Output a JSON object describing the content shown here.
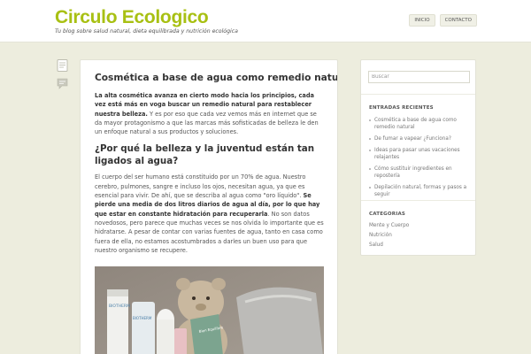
{
  "header": {
    "site_title": "Circulo Ecologico",
    "site_description": "Tu blog sobre salud natural, dieta equilibrada y nutrición ecológica",
    "nav": [
      {
        "label": "INICIO"
      },
      {
        "label": "CONTACTO"
      }
    ]
  },
  "side_icons": [
    "document-icon",
    "comment-icon"
  ],
  "post": {
    "title": "Cosmética a base de agua como remedio natural",
    "intro_bold": "La alta cosmética avanza en cierto modo hacia los principios, cada vez está más en voga buscar un remedio natural para restablecer nuestra belleza.",
    "intro_rest": " Y es por eso que cada vez vemos más en internet que se da mayor protagonismo a que las marcas más sofisticadas de belleza le den un enfoque natural a sus productos y soluciones.",
    "subheading": "¿Por qué la belleza y la juventud están tan ligados al agua?",
    "body_1": "El cuerpo del ser humano está constituido por un 70% de agua. Nuestro cerebro, pulmones, sangre e incluso los ojos, necesitan agua, ya que es esencial para vivir. De ahí, que se describa al agua como \"oro líquido\". ",
    "body_bold": "Se pierde una media de dos litros diarios de agua al día, por lo que hay que estar en constante hidratación para recuperarla",
    "body_2": ". No son datos novedosos, pero parece que muchas veces se nos olvida lo importante que es hidratarse. A pesar de contar con varias fuentes de agua, tanto en casa como fuera de ella, no estamos acostumbrados a darles un buen uso para que nuestro organismo  se recupere.",
    "image_labels": [
      "BIOTHERM",
      "BIOTHERM",
      "Bien Equilibre"
    ]
  },
  "sidebar": {
    "search_placeholder": "Buscar",
    "recent_title": "ENTRADAS RECIENTES",
    "recent_posts": [
      "Cosmética a base de agua como remedio natural",
      "De fumar a vapear ¿Funciona?",
      "Ideas para pasar unas vacaciones relajantes",
      "Cómo sustituir ingredientes en repostería",
      "Depilación natural, formas y pasos a seguir"
    ],
    "categories_title": "CATEGORIAS",
    "categories": [
      "Mente y Cuerpo",
      "Nutrición",
      "Salud"
    ]
  },
  "colors": {
    "accent": "#a8c013",
    "background": "#ededde",
    "card": "#ffffff"
  }
}
